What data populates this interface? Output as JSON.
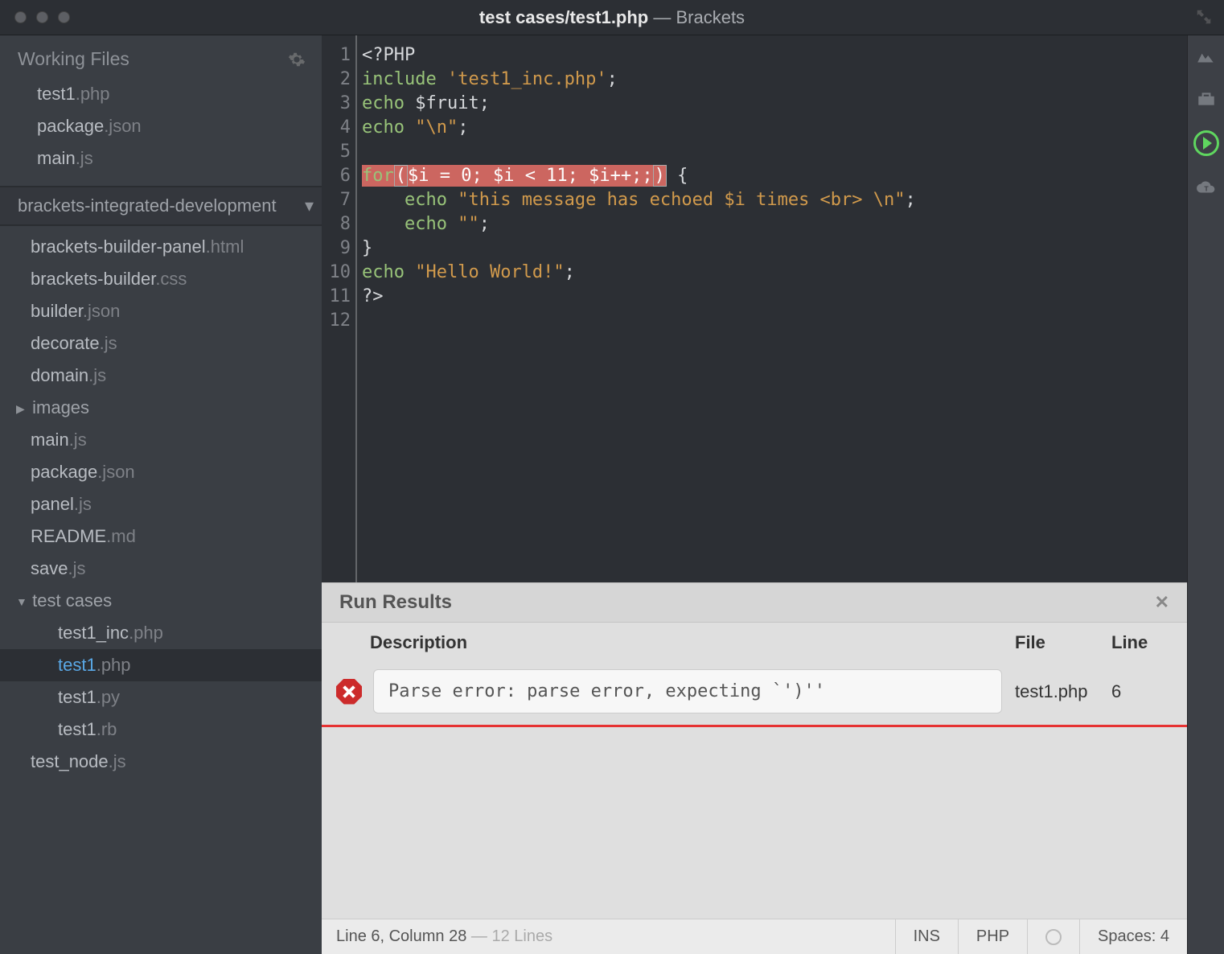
{
  "titlebar": {
    "path": "test cases/test1.php",
    "sep": " — ",
    "app": "Brackets"
  },
  "sidebar": {
    "working_files_label": "Working Files",
    "working_files": [
      {
        "name": "test1",
        "ext": ".php"
      },
      {
        "name": "package",
        "ext": ".json"
      },
      {
        "name": "main",
        "ext": ".js"
      }
    ],
    "project_name": "brackets-integrated-development",
    "tree": [
      {
        "name": "brackets-builder-panel",
        "ext": ".html",
        "indent": 1,
        "type": "file"
      },
      {
        "name": "brackets-builder",
        "ext": ".css",
        "indent": 1,
        "type": "file"
      },
      {
        "name": "builder",
        "ext": ".json",
        "indent": 1,
        "type": "file"
      },
      {
        "name": "decorate",
        "ext": ".js",
        "indent": 1,
        "type": "file"
      },
      {
        "name": "domain",
        "ext": ".js",
        "indent": 1,
        "type": "file"
      },
      {
        "name": "images",
        "ext": "",
        "indent": 1,
        "type": "folder-closed"
      },
      {
        "name": "main",
        "ext": ".js",
        "indent": 1,
        "type": "file"
      },
      {
        "name": "package",
        "ext": ".json",
        "indent": 1,
        "type": "file"
      },
      {
        "name": "panel",
        "ext": ".js",
        "indent": 1,
        "type": "file"
      },
      {
        "name": "README",
        "ext": ".md",
        "indent": 1,
        "type": "file"
      },
      {
        "name": "save",
        "ext": ".js",
        "indent": 1,
        "type": "file"
      },
      {
        "name": "test cases",
        "ext": "",
        "indent": 1,
        "type": "folder-open"
      },
      {
        "name": "test1_inc",
        "ext": ".php",
        "indent": 2,
        "type": "file"
      },
      {
        "name": "test1",
        "ext": ".php",
        "indent": 2,
        "type": "file",
        "active": true
      },
      {
        "name": "test1",
        "ext": ".py",
        "indent": 2,
        "type": "file"
      },
      {
        "name": "test1",
        "ext": ".rb",
        "indent": 2,
        "type": "file"
      },
      {
        "name": "test_node",
        "ext": ".js",
        "indent": 1,
        "type": "file"
      }
    ]
  },
  "editor": {
    "line_count": 12,
    "highlighted_line": 6,
    "lines": [
      "<?PHP",
      "include 'test1_inc.php';",
      "echo $fruit;",
      "echo \"\\n\";",
      "",
      "for($i = 0; $i < 11; $i++;;) {",
      "    echo \"this message has echoed $i times <br> \\n\";",
      "    echo \"\";",
      "}",
      "echo \"Hello World!\";",
      "?>",
      ""
    ]
  },
  "results": {
    "title": "Run Results",
    "columns": {
      "desc": "Description",
      "file": "File",
      "line": "Line"
    },
    "rows": [
      {
        "description": "Parse error: parse error, expecting `')''",
        "file": "test1.php",
        "line": "6"
      }
    ]
  },
  "statusbar": {
    "cursor": "Line 6, Column 28",
    "sep": " — ",
    "total": "12 Lines",
    "ins": "INS",
    "lang": "PHP",
    "spaces": "Spaces:  4"
  }
}
